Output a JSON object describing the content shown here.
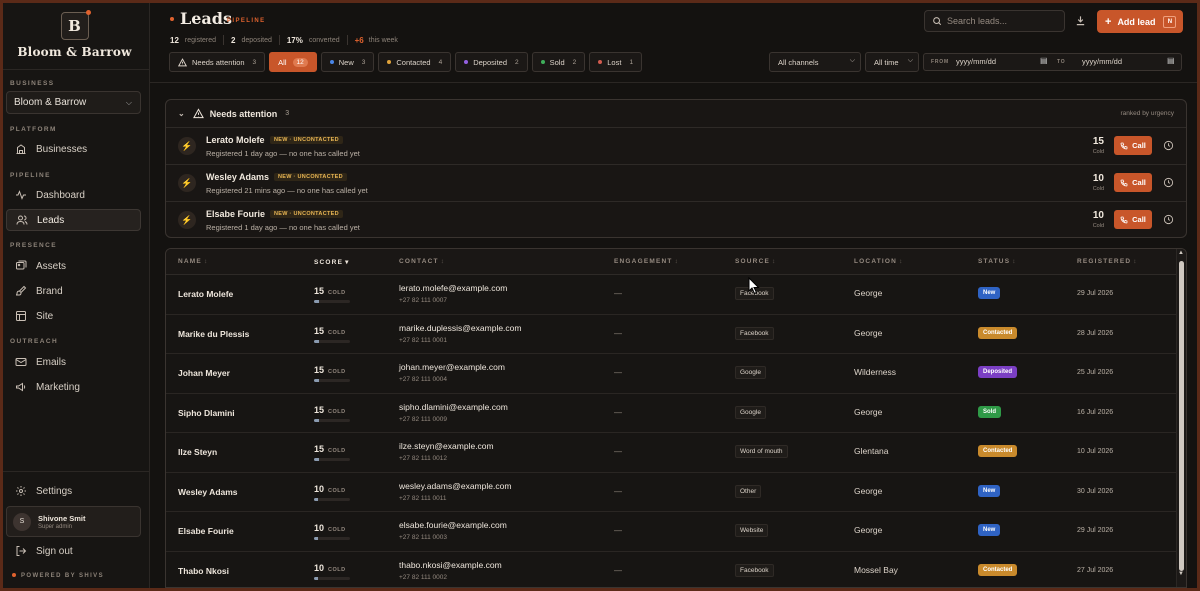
{
  "brand": {
    "initial": "B",
    "name": "Bloom & Barrow"
  },
  "sidebar": {
    "business_label": "BUSINESS",
    "business_value": "Bloom & Barrow",
    "sections": {
      "platform": "PLATFORM",
      "pipeline": "PIPELINE",
      "presence": "PRESENCE",
      "outreach": "OUTREACH"
    },
    "items": {
      "businesses": "Businesses",
      "dashboard": "Dashboard",
      "leads": "Leads",
      "assets": "Assets",
      "brand": "Brand",
      "site": "Site",
      "emails": "Emails",
      "marketing": "Marketing"
    },
    "settings": "Settings",
    "user": {
      "initial": "S",
      "name": "Shivone Smit",
      "role": "Super admin"
    },
    "sign_out": "Sign out",
    "powered": "POWERED BY SHIVS"
  },
  "header": {
    "title": "Leads",
    "tag": "PIPELINE",
    "stats": {
      "registered_count": "12",
      "registered_label": "registered",
      "deposited_count": "2",
      "deposited_label": "deposited",
      "converted_pct": "17%",
      "converted_label": "converted",
      "week_count": "+6",
      "week_label": "this week"
    },
    "search_placeholder": "Search leads...",
    "add_lead": "Add lead",
    "add_lead_kbd": "N"
  },
  "filters": {
    "chips": [
      {
        "label": "Needs attention",
        "count": "3"
      },
      {
        "label": "All",
        "count": "12"
      },
      {
        "label": "New",
        "count": "3"
      },
      {
        "label": "Contacted",
        "count": "4"
      },
      {
        "label": "Deposited",
        "count": "2"
      },
      {
        "label": "Sold",
        "count": "2"
      },
      {
        "label": "Lost",
        "count": "1"
      }
    ],
    "channel": "All channels",
    "time": "All time",
    "from_label": "FROM",
    "from_value": "yyyy/mm/dd",
    "to_label": "TO",
    "to_value": "yyyy/mm/dd"
  },
  "attention": {
    "title": "Needs attention",
    "count": "3",
    "ranked": "ranked by urgency",
    "call_label": "Call",
    "rows": [
      {
        "name": "Lerato Molefe",
        "badge": "NEW · UNCONTACTED",
        "sub": "Registered 1 day ago — no one has called yet",
        "score": "15",
        "temp": "Cold"
      },
      {
        "name": "Wesley Adams",
        "badge": "NEW · UNCONTACTED",
        "sub": "Registered 21 mins ago — no one has called yet",
        "score": "10",
        "temp": "Cold"
      },
      {
        "name": "Elsabe Fourie",
        "badge": "NEW · UNCONTACTED",
        "sub": "Registered 1 day ago — no one has called yet",
        "score": "10",
        "temp": "Cold"
      }
    ]
  },
  "table": {
    "columns": {
      "name": "NAME",
      "score": "SCORE",
      "contact": "CONTACT",
      "engagement": "ENGAGEMENT",
      "source": "SOURCE",
      "location": "LOCATION",
      "status": "STATUS",
      "registered": "REGISTERED"
    },
    "rows": [
      {
        "name": "Lerato Molefe",
        "score": "15",
        "temp": "COLD",
        "email": "lerato.molefe@example.com",
        "phone": "+27 82 111 0007",
        "engagement": "—",
        "source": "Facebook",
        "location": "George",
        "status": "New",
        "registered": "29 Jul 2026"
      },
      {
        "name": "Marike du Plessis",
        "score": "15",
        "temp": "COLD",
        "email": "marike.duplessis@example.com",
        "phone": "+27 82 111 0001",
        "engagement": "—",
        "source": "Facebook",
        "location": "George",
        "status": "Contacted",
        "registered": "28 Jul 2026"
      },
      {
        "name": "Johan Meyer",
        "score": "15",
        "temp": "COLD",
        "email": "johan.meyer@example.com",
        "phone": "+27 82 111 0004",
        "engagement": "—",
        "source": "Google",
        "location": "Wilderness",
        "status": "Deposited",
        "registered": "25 Jul 2026"
      },
      {
        "name": "Sipho Dlamini",
        "score": "15",
        "temp": "COLD",
        "email": "sipho.dlamini@example.com",
        "phone": "+27 82 111 0009",
        "engagement": "—",
        "source": "Google",
        "location": "George",
        "status": "Sold",
        "registered": "16 Jul 2026"
      },
      {
        "name": "Ilze Steyn",
        "score": "15",
        "temp": "COLD",
        "email": "ilze.steyn@example.com",
        "phone": "+27 82 111 0012",
        "engagement": "—",
        "source": "Word of mouth",
        "location": "Glentana",
        "status": "Contacted",
        "registered": "10 Jul 2026"
      },
      {
        "name": "Wesley Adams",
        "score": "10",
        "temp": "COLD",
        "email": "wesley.adams@example.com",
        "phone": "+27 82 111 0011",
        "engagement": "—",
        "source": "Other",
        "location": "George",
        "status": "New",
        "registered": "30 Jul 2026"
      },
      {
        "name": "Elsabe Fourie",
        "score": "10",
        "temp": "COLD",
        "email": "elsabe.fourie@example.com",
        "phone": "+27 82 111 0003",
        "engagement": "—",
        "source": "Website",
        "location": "George",
        "status": "New",
        "registered": "29 Jul 2026"
      },
      {
        "name": "Thabo Nkosi",
        "score": "10",
        "temp": "COLD",
        "email": "thabo.nkosi@example.com",
        "phone": "+27 82 111 0002",
        "engagement": "—",
        "source": "Facebook",
        "location": "Mossel Bay",
        "status": "Contacted",
        "registered": "27 Jul 2026"
      }
    ]
  },
  "colors": {
    "accent": "#c8562a",
    "status_new": "#2f63c4",
    "status_contacted": "#c98a2c",
    "status_deposited": "#7b3fc4",
    "status_sold": "#2f9a47",
    "status_lost": "#b3413a"
  }
}
